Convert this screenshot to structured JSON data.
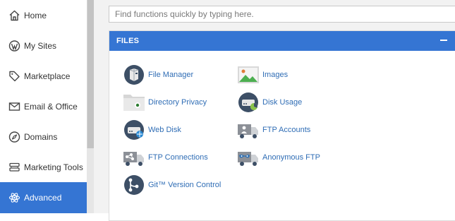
{
  "sidebar": {
    "items": [
      {
        "label": "Home",
        "icon": "home-icon"
      },
      {
        "label": "My Sites",
        "icon": "wordpress-icon"
      },
      {
        "label": "Marketplace",
        "icon": "tag-icon"
      },
      {
        "label": "Email & Office",
        "icon": "mail-icon"
      },
      {
        "label": "Domains",
        "icon": "compass-icon"
      },
      {
        "label": "Marketing Tools",
        "icon": "stack-icon"
      },
      {
        "label": "Advanced",
        "icon": "atom-icon",
        "active": true
      }
    ]
  },
  "search": {
    "placeholder": "Find functions quickly by typing here."
  },
  "files_panel": {
    "title": "FILES",
    "items": [
      {
        "label": "File Manager",
        "icon": "file-manager-icon"
      },
      {
        "label": "Images",
        "icon": "images-icon"
      },
      {
        "label": "Directory Privacy",
        "icon": "directory-privacy-icon"
      },
      {
        "label": "Disk Usage",
        "icon": "disk-usage-icon"
      },
      {
        "label": "Web Disk",
        "icon": "web-disk-icon"
      },
      {
        "label": "FTP Accounts",
        "icon": "ftp-accounts-icon"
      },
      {
        "label": "FTP Connections",
        "icon": "ftp-connections-icon"
      },
      {
        "label": "Anonymous FTP",
        "icon": "anonymous-ftp-icon"
      },
      {
        "label": "Git™ Version Control",
        "icon": "git-icon"
      }
    ]
  },
  "colors": {
    "accent": "#3575d3",
    "link": "#2f6db5",
    "icon_dark": "#3d4f66"
  }
}
